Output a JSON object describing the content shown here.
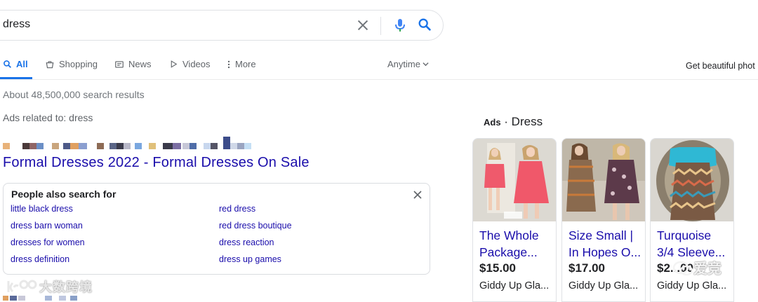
{
  "search": {
    "query": "dress"
  },
  "tabs": [
    {
      "label": "All",
      "icon": "search-icon"
    },
    {
      "label": "Shopping",
      "icon": "shopping-bag-icon"
    },
    {
      "label": "News",
      "icon": "news-icon"
    },
    {
      "label": "Videos",
      "icon": "play-icon"
    },
    {
      "label": "More",
      "icon": "more-vert-icon"
    }
  ],
  "tools": {
    "time_filter": "Anytime"
  },
  "sidebar_promo": "Get beautiful phot",
  "results": {
    "stats": "About 48,500,000 search results",
    "ads_related": "Ads related to: dress",
    "ad_title": "Formal Dresses 2022 - Formal Dresses On Sale"
  },
  "people_also_search": {
    "title": "People also search for",
    "left": [
      "little black dress",
      "dress barn woman",
      "dresses for women",
      "dress definition"
    ],
    "right": [
      "red dress",
      "red dress boutique",
      "dress reaction",
      "dress up games"
    ]
  },
  "shopping_ads": {
    "label": "Ads",
    "heading": "Dress",
    "cards": [
      {
        "title": "The Whole Package...",
        "price": "$15.00",
        "merchant": "Giddy Up Gla..."
      },
      {
        "title": "Size Small | In Hopes O...",
        "price": "$17.00",
        "merchant": "Giddy Up Gla..."
      },
      {
        "title": "Turquoise 3/4 Sleeve...",
        "price": "$2...00",
        "merchant": "Giddy Up Gla..."
      }
    ]
  },
  "watermark": {
    "left": "大数跨境",
    "right": "爱竞"
  },
  "colors": {
    "link": "#1a0dab",
    "accent": "#1a73e8"
  }
}
